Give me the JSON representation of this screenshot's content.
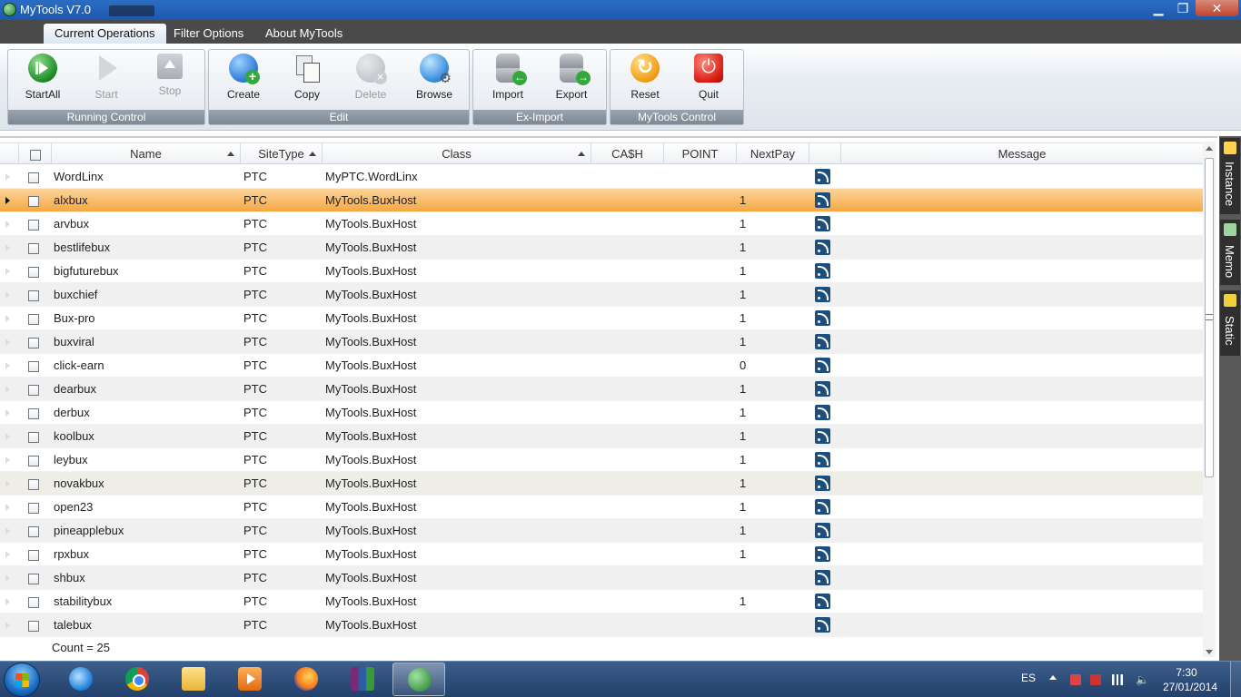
{
  "window": {
    "title": "MyTools V7.0"
  },
  "ribbon": {
    "tabs": [
      {
        "label": "Current Operations",
        "active": true
      },
      {
        "label": "Filter Options",
        "active": false
      },
      {
        "label": "About MyTools",
        "active": false
      }
    ],
    "groups": {
      "running_control": {
        "label": "Running Control",
        "buttons": [
          "StartAll",
          "Start",
          "Stop"
        ]
      },
      "edit": {
        "label": "Edit",
        "buttons": [
          "Create",
          "Copy",
          "Delete",
          "Browse"
        ]
      },
      "ex_import": {
        "label": "Ex-Import",
        "buttons": [
          "Import",
          "Export"
        ]
      },
      "mytools_control": {
        "label": "MyTools Control",
        "buttons": [
          "Reset",
          "Quit"
        ]
      }
    }
  },
  "grid": {
    "columns": [
      "Name",
      "SiteType",
      "Class",
      "CA$H",
      "POINT",
      "NextPay",
      "",
      "Message"
    ],
    "rows": [
      {
        "name": "WordLinx",
        "site_type": "PTC",
        "class": "MyPTC.WordLinx",
        "cash": "",
        "point": "",
        "next_pay": ""
      },
      {
        "name": "alxbux",
        "site_type": "PTC",
        "class": "MyTools.BuxHost",
        "cash": "",
        "point": "",
        "next_pay": "1"
      },
      {
        "name": "arvbux",
        "site_type": "PTC",
        "class": "MyTools.BuxHost",
        "cash": "",
        "point": "",
        "next_pay": "1"
      },
      {
        "name": "bestlifebux",
        "site_type": "PTC",
        "class": "MyTools.BuxHost",
        "cash": "",
        "point": "",
        "next_pay": "1"
      },
      {
        "name": "bigfuturebux",
        "site_type": "PTC",
        "class": "MyTools.BuxHost",
        "cash": "",
        "point": "",
        "next_pay": "1"
      },
      {
        "name": "buxchief",
        "site_type": "PTC",
        "class": "MyTools.BuxHost",
        "cash": "",
        "point": "",
        "next_pay": "1"
      },
      {
        "name": "Bux-pro",
        "site_type": "PTC",
        "class": "MyTools.BuxHost",
        "cash": "",
        "point": "",
        "next_pay": "1"
      },
      {
        "name": "buxviral",
        "site_type": "PTC",
        "class": "MyTools.BuxHost",
        "cash": "",
        "point": "",
        "next_pay": "1"
      },
      {
        "name": "click-earn",
        "site_type": "PTC",
        "class": "MyTools.BuxHost",
        "cash": "",
        "point": "",
        "next_pay": "0"
      },
      {
        "name": "dearbux",
        "site_type": "PTC",
        "class": "MyTools.BuxHost",
        "cash": "",
        "point": "",
        "next_pay": "1"
      },
      {
        "name": "derbux",
        "site_type": "PTC",
        "class": "MyTools.BuxHost",
        "cash": "",
        "point": "",
        "next_pay": "1"
      },
      {
        "name": "koolbux",
        "site_type": "PTC",
        "class": "MyTools.BuxHost",
        "cash": "",
        "point": "",
        "next_pay": "1"
      },
      {
        "name": "leybux",
        "site_type": "PTC",
        "class": "MyTools.BuxHost",
        "cash": "",
        "point": "",
        "next_pay": "1"
      },
      {
        "name": "novakbux",
        "site_type": "PTC",
        "class": "MyTools.BuxHost",
        "cash": "",
        "point": "",
        "next_pay": "1"
      },
      {
        "name": "open23",
        "site_type": "PTC",
        "class": "MyTools.BuxHost",
        "cash": "",
        "point": "",
        "next_pay": "1"
      },
      {
        "name": "pineapplebux",
        "site_type": "PTC",
        "class": "MyTools.BuxHost",
        "cash": "",
        "point": "",
        "next_pay": "1"
      },
      {
        "name": "rpxbux",
        "site_type": "PTC",
        "class": "MyTools.BuxHost",
        "cash": "",
        "point": "",
        "next_pay": "1"
      },
      {
        "name": "shbux",
        "site_type": "PTC",
        "class": "MyTools.BuxHost",
        "cash": "",
        "point": "",
        "next_pay": ""
      },
      {
        "name": "stabilitybux",
        "site_type": "PTC",
        "class": "MyTools.BuxHost",
        "cash": "",
        "point": "",
        "next_pay": "1"
      },
      {
        "name": "talebux",
        "site_type": "PTC",
        "class": "MyTools.BuxHost",
        "cash": "",
        "point": "",
        "next_pay": ""
      }
    ],
    "selected_row": 1,
    "count_label": "Count = 25"
  },
  "side_tabs": [
    "Instance",
    "Memo",
    "Static"
  ],
  "taskbar": {
    "apps": [
      "internet-explorer",
      "chrome",
      "file-explorer",
      "media-player",
      "firefox",
      "winrar",
      "mytools"
    ],
    "active_app": "mytools",
    "language": "ES",
    "time": "7:30",
    "date": "27/01/2014"
  },
  "colors": {
    "selected_row": "#f5a742",
    "title_bar": "#1d58ad",
    "ribbon_tabs_bg": "#4a4a4a"
  }
}
